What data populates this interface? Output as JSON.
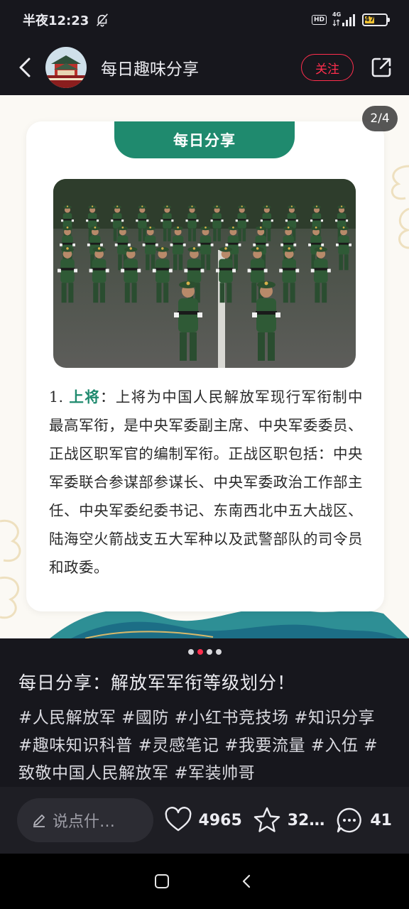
{
  "status_bar": {
    "time": "半夜12:23",
    "network": "4G",
    "hd": "HD",
    "battery_percent": "47",
    "battery_level": 0.47
  },
  "nav": {
    "account_name": "每日趣味分享",
    "follow_label": "关注",
    "back_icon": "chevron-left-icon",
    "share_icon": "share-external-icon"
  },
  "post": {
    "page_indicator": "2/4",
    "card_tab": "每日分享",
    "article_number": "1.",
    "article_term": "上将",
    "article_body": "：上将为中国人民解放军现行军衔制中最高军衔，是中央军委副主席、中央军委委员、正战区职军官的编制军衔。正战区职包括：中央军委联合参谋部参谋长、中央军委政治工作部主任、中央军委纪委书记、东南西北中五大战区、陆海空火箭战支五大军种以及武警部队的司令员和政委。",
    "accent_color": "#1f8a6e",
    "total_pages": 4,
    "current_page": 2
  },
  "content": {
    "title": "每日分享：解放军军衔等级划分！",
    "tags": [
      "#人民解放军",
      "#國防",
      "#小红书竞技场",
      "#知识分享",
      "#趣味知识科普",
      "#灵感笔记",
      "#我要流量",
      "#入伍",
      "#致敬中国人民解放军",
      "#军装帅哥"
    ]
  },
  "bottom_bar": {
    "comment_placeholder": "说点什…",
    "likes": "4965",
    "favorites": "32…",
    "comments": "41"
  },
  "colors": {
    "brand_red": "#ff2e4d",
    "background": "#17171d"
  }
}
